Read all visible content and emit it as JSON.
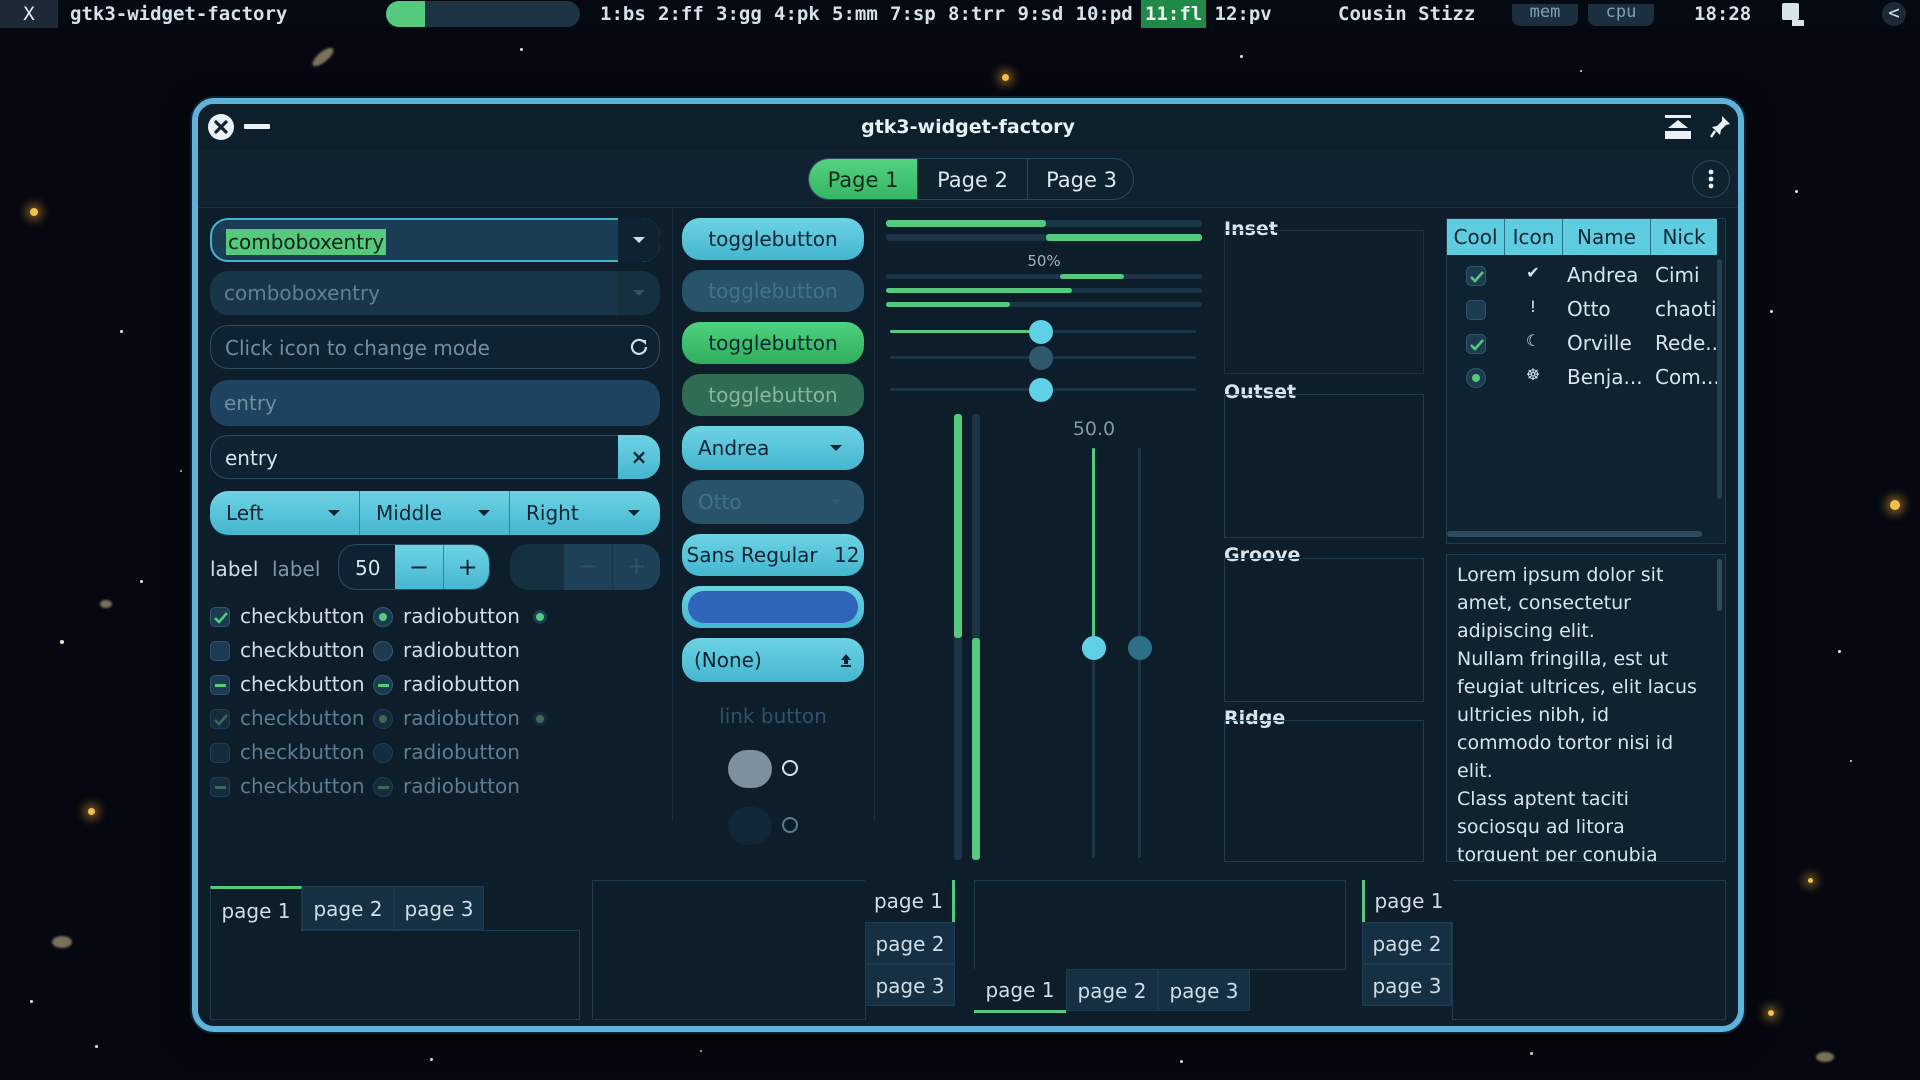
{
  "topbar": {
    "x_label": "X",
    "app_name": "gtk3-widget-factory",
    "progress": 0.2,
    "workspaces": [
      "1:bs",
      "2:ff",
      "3:gg",
      "4:pk",
      "5:mm",
      "7:sp",
      "8:trr",
      "9:sd",
      "10:pd",
      "11:fl",
      "12:pv"
    ],
    "active_workspace": "11:fl",
    "user": "Cousin Stizz",
    "mem_label": "mem",
    "cpu_label": "cpu",
    "clock": "18:28",
    "collapse_label": "<"
  },
  "window": {
    "title": "gtk3-widget-factory",
    "tabs": [
      "Page 1",
      "Page 2",
      "Page 3"
    ],
    "active_tab": "Page 1"
  },
  "left": {
    "combo1_value": "comboboxentry",
    "combo2_value": "comboboxentry",
    "icon_entry_placeholder": "Click icon to change mode",
    "entry_placeholder": "entry",
    "entry_value": "entry",
    "clear_icon": "×",
    "segments": [
      "Left",
      "Middle",
      "Right"
    ],
    "label1": "label",
    "label2": "label",
    "spin_value": "50",
    "minus": "−",
    "plus": "+",
    "checks": [
      "checkbutton",
      "checkbutton",
      "checkbutton",
      "checkbutton",
      "checkbutton",
      "checkbutton"
    ],
    "radios": [
      "radiobutton",
      "radiobutton",
      "radiobutton",
      "radiobutton",
      "radiobutton",
      "radiobutton"
    ]
  },
  "middle": {
    "toggle_labels": [
      "togglebutton",
      "togglebutton",
      "togglebutton",
      "togglebutton"
    ],
    "combo_value": "Andrea",
    "combo_disabled_value": "Otto",
    "font_button": "Sans Regular",
    "font_size": "12",
    "file_button": "(None)",
    "link_button": "link button"
  },
  "progress": {
    "percent_label": "50%",
    "scale_value_label": "50.0"
  },
  "frames": [
    "Inset",
    "Outset",
    "Groove",
    "Ridge"
  ],
  "tree": {
    "columns": [
      "Cool",
      "Icon",
      "Name",
      "Nick"
    ],
    "rows": [
      {
        "cool": true,
        "icon": "✔",
        "name": "Andrea",
        "nick": "Cimi"
      },
      {
        "cool": false,
        "icon": "!",
        "name": "Otto",
        "nick": "chaoti"
      },
      {
        "cool": true,
        "icon": "☾",
        "name": "Orville",
        "nick": "Rede..."
      },
      {
        "cool": "radio",
        "icon": "☸",
        "name": "Benja...",
        "nick": "Com..."
      }
    ]
  },
  "textview": {
    "lines": [
      "Lorem ipsum dolor sit",
      "amet, consectetur",
      "adipiscing elit.",
      "Nullam fringilla, est ut",
      "feugiat ultrices, elit lacus",
      "ultricies nibh, id",
      "commodo tortor nisi id",
      "elit.",
      "Class aptent taciti",
      "sociosqu ad litora",
      "torquent per conubia"
    ]
  },
  "notebooks": {
    "pages": [
      "page 1",
      "page 2",
      "page 3"
    ]
  }
}
